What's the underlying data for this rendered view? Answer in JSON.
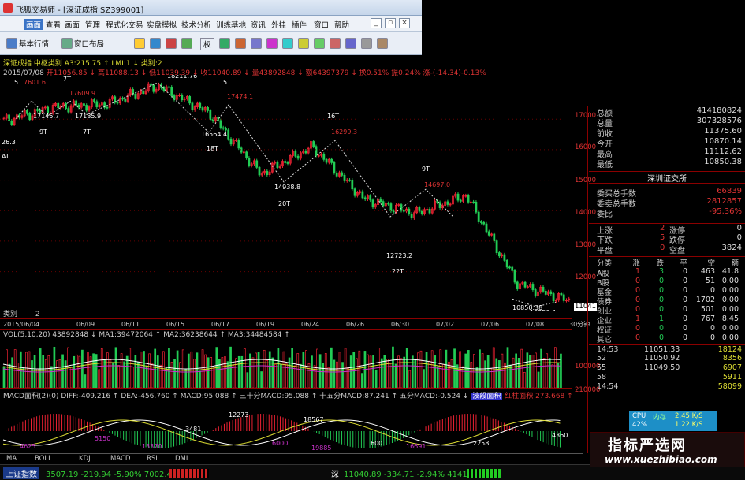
{
  "window": {
    "title": "飞狐交易师 - [深证成指 SZ399001]"
  },
  "menu": [
    "画面",
    "查看",
    "画面",
    "管理",
    "程式化交易",
    "实盘模拟",
    "技术分析",
    "训练基地",
    "资讯",
    "外挂",
    "插件",
    "窗口",
    "帮助"
  ],
  "toolbar": {
    "basic_quotes": "基本行情",
    "window_layout": "窗口布局",
    "quan": "权"
  },
  "main": {
    "header1": "深证成指  中枢类别 A3:215.75 ↑ LMI:1 ↓ 类别:2",
    "header2_date": "2015/07/08",
    "header2_quote": "开11056.85 ↓ 高11088.13 ↓ 低11039.39 ↓ 收11040.89 ↓ 量43892848 ↓ 额64397379 ↓ 换0.51% 振0.24% 涨-(-14.34)-0.13%",
    "category_label": "类别",
    "category_value": "2",
    "annotations": [
      {
        "text": "5T",
        "color": "#fff"
      },
      {
        "text": "7601.6",
        "color": "#d33"
      },
      {
        "text": "7T",
        "color": "#fff"
      },
      {
        "text": "17609.9",
        "color": "#d33"
      },
      {
        "text": "9T",
        "color": "#fff"
      },
      {
        "text": "7T",
        "color": "#fff"
      },
      {
        "text": "17145.7",
        "color": "#fff"
      },
      {
        "text": "17185.9",
        "color": "#fff"
      },
      {
        "text": "18211.76",
        "color": "#fff"
      },
      {
        "text": "5T",
        "color": "#fff"
      },
      {
        "text": "17474.1",
        "color": "#d33"
      },
      {
        "text": "16564.4",
        "color": "#fff"
      },
      {
        "text": "18T",
        "color": "#fff"
      },
      {
        "text": "16T",
        "color": "#fff"
      },
      {
        "text": "16299.3",
        "color": "#d33"
      },
      {
        "text": "14938.8",
        "color": "#fff"
      },
      {
        "text": "20T",
        "color": "#fff"
      },
      {
        "text": "9T",
        "color": "#fff"
      },
      {
        "text": "14697.0",
        "color": "#d33"
      },
      {
        "text": "12723.2",
        "color": "#fff"
      },
      {
        "text": "22T",
        "color": "#fff"
      },
      {
        "text": "10850.38",
        "color": "#fff"
      },
      {
        "text": "10850.4",
        "color": "#fff"
      },
      {
        "text": "26.3",
        "color": "#fff"
      },
      {
        "text": "AT",
        "color": "#fff"
      }
    ],
    "dates": [
      "2015/06/04",
      "06/09",
      "06/11",
      "06/15",
      "06/17",
      "06/19",
      "06/24",
      "06/26",
      "06/30",
      "07/02",
      "07/06",
      "07/08"
    ],
    "timeframe": "30分钟",
    "vol_header": "VOL(5,10,20)  43892848 ↓  MA1:39472064 ↑  MA2:36238644 ↑  MA3:34484584 ↑",
    "macd_header": "MACD面积(2)(0)  DIFF:-409.216 ↑  DEA:-456.760 ↑  MACD:95.088 ↑  三十分MACD:95.088 ↑  十五分MACD:87.241 ↑  五分MACD:-0.524 ↓",
    "macd_tags": [
      "波段面积",
      "红柱面积 273.668 ↑"
    ],
    "macd_labels": [
      {
        "text": "4625",
        "color": "#c3c"
      },
      {
        "text": "5150",
        "color": "#c3c"
      },
      {
        "text": "13370",
        "color": "#c3c"
      },
      {
        "text": "3481",
        "color": "#fff"
      },
      {
        "text": "12273",
        "color": "#fff"
      },
      {
        "text": "6000",
        "color": "#c3c"
      },
      {
        "text": "18567",
        "color": "#fff"
      },
      {
        "text": "19885",
        "color": "#c3c"
      },
      {
        "text": "600",
        "color": "#fff"
      },
      {
        "text": "16691",
        "color": "#c3c"
      },
      {
        "text": "2258",
        "color": "#fff"
      },
      {
        "text": "4360",
        "color": "#fff"
      }
    ],
    "price_axis": [
      "17000",
      "16000",
      "15000",
      "14000",
      "13000",
      "12000",
      "11041"
    ],
    "vol_axis": [
      "100000",
      "210000"
    ]
  },
  "chart_data": {
    "type": "candlestick",
    "title": "深证成指",
    "dates": [
      "2015/06/04",
      "06/09",
      "06/11",
      "06/15",
      "06/17",
      "06/19",
      "06/24",
      "06/26",
      "06/30",
      "07/02",
      "07/06",
      "07/08"
    ],
    "close": [
      16950,
      17400,
      17500,
      18100,
      17200,
      15200,
      16100,
      14400,
      13900,
      14500,
      11600,
      11040
    ],
    "ylim": [
      10800,
      18300
    ],
    "volume_ma": {
      "MA1": 39472064,
      "MA2": 36238644,
      "MA3": 34484584
    },
    "macd": {
      "DIFF": -409.216,
      "DEA": -456.76,
      "MACD": 95.088
    }
  },
  "info": {
    "rows": [
      {
        "k": "总额",
        "v": "414180824",
        "c": "#ddd"
      },
      {
        "k": "总量",
        "v": "307328576",
        "c": "#ddd"
      },
      {
        "k": "前收",
        "v": "11375.60",
        "c": "#ddd"
      },
      {
        "k": "今开",
        "v": "10870.14",
        "c": "#ddd"
      },
      {
        "k": "最高",
        "v": "11112.62",
        "c": "#ddd"
      },
      {
        "k": "最低",
        "v": "10850.38",
        "c": "#ddd"
      }
    ],
    "exchange": "深圳证交所",
    "orders": [
      {
        "k": "委买总手数",
        "v": "66839",
        "c": "#d33"
      },
      {
        "k": "委卖总手数",
        "v": "2812857",
        "c": "#d33"
      },
      {
        "k": "委比",
        "v": "-95.36%",
        "c": "#d33"
      }
    ],
    "breadth": [
      {
        "k1": "上涨",
        "v1": "2",
        "k2": "涨停",
        "v2": "0"
      },
      {
        "k1": "下跌",
        "v1": "5",
        "k2": "跌停",
        "v2": "0"
      },
      {
        "k1": "平盘",
        "v1": "0",
        "k2": "空盘",
        "v2": "3824"
      }
    ],
    "table_header": [
      "分类",
      "涨",
      "跌",
      "平",
      "空",
      "额"
    ],
    "table_rows": [
      [
        "A股",
        "1",
        "3",
        "0",
        "463",
        "41.8"
      ],
      [
        "B股",
        "0",
        "0",
        "0",
        "51",
        "0.00"
      ],
      [
        "基金",
        "0",
        "0",
        "0",
        "0",
        "0.00"
      ],
      [
        "债券",
        "0",
        "0",
        "0",
        "1702",
        "0.00"
      ],
      [
        "创业",
        "0",
        "0",
        "0",
        "501",
        "0.00"
      ],
      [
        "企业",
        "1",
        "1",
        "0",
        "767",
        "8.45"
      ],
      [
        "权证",
        "0",
        "0",
        "0",
        "0",
        "0.00"
      ],
      [
        "其它",
        "0",
        "0",
        "0",
        "0",
        "0.00"
      ]
    ],
    "ticks": [
      {
        "t": "14:53",
        "p": "11051.33",
        "v": "18124"
      },
      {
        "t": "52",
        "p": "11050.92",
        "v": "8356"
      },
      {
        "t": "55",
        "p": "11049.50",
        "v": "6907"
      },
      {
        "t": "58",
        "p": "",
        "v": "5911"
      },
      {
        "t": "14:54",
        "p": "",
        "v": "58099"
      }
    ]
  },
  "cpu": {
    "label": "CPU",
    "val": "42%",
    "mem": "内存",
    "up": "2.45 K/S",
    "down": "1.22 K/S"
  },
  "bottom_tabs": [
    "MA",
    "BOLL",
    "KDJ",
    "MACD",
    "RSI",
    "DMI"
  ],
  "status": {
    "sh_label": "上证指数",
    "sh_value": "3507.19 -219.94 -5.90% 7002.48亿",
    "sz_label": "深",
    "sz_value": "11040.89 -334.71 -2.94% 4141.88亿"
  },
  "watermark": {
    "title": "指标严选网",
    "url": "www.xuezhibiao.com"
  }
}
